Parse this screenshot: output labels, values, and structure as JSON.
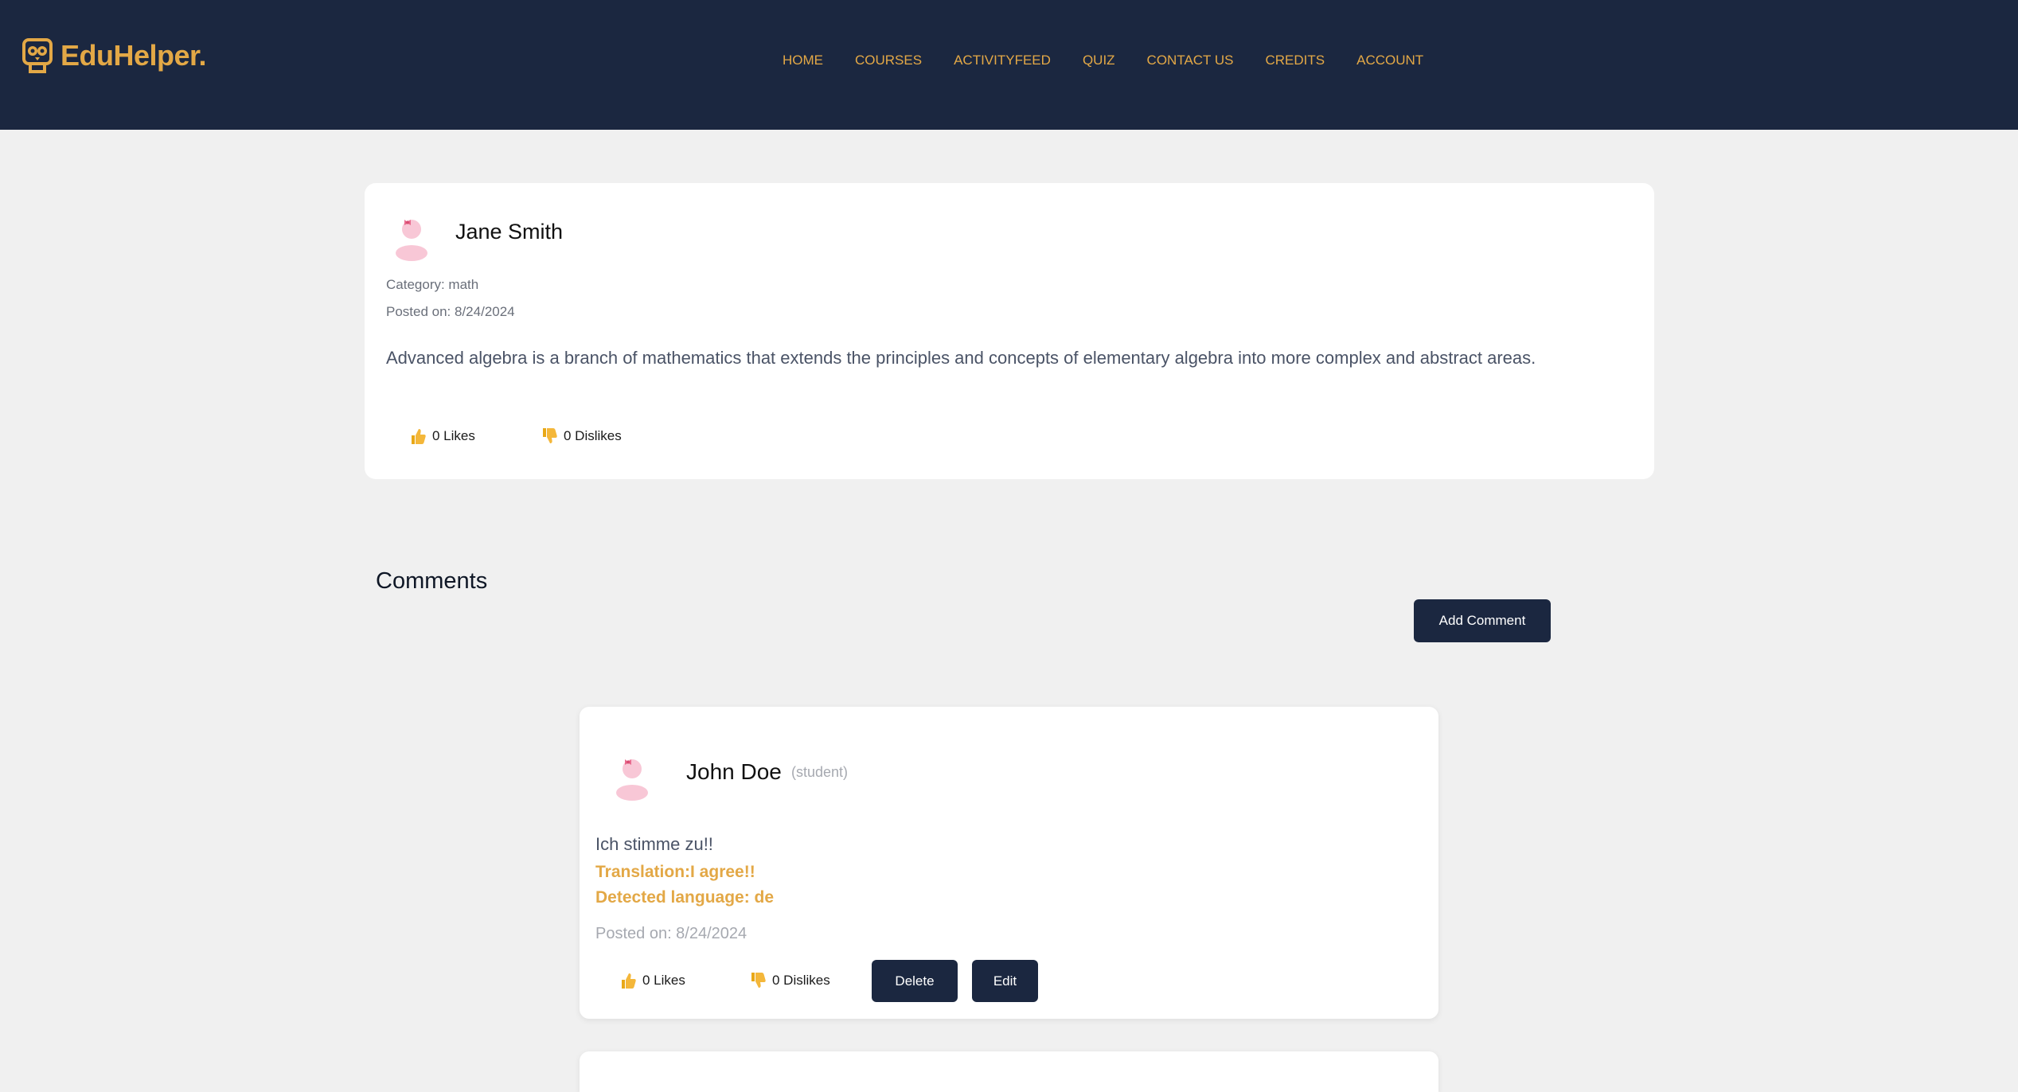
{
  "brand": {
    "name": "EduHelper."
  },
  "nav": {
    "items": [
      "HOME",
      "COURSES",
      "ACTIVITYFEED",
      "QUIZ",
      "CONTACT US",
      "CREDITS",
      "ACCOUNT"
    ]
  },
  "colors": {
    "navy": "#1b2740",
    "gold": "#e3a846",
    "background": "#f0f0f0"
  },
  "post": {
    "author": "Jane Smith",
    "category": "Category: math",
    "posted": "Posted on: 8/24/2024",
    "body": "Advanced algebra is a branch of mathematics that extends the principles and concepts of elementary algebra into more complex and abstract areas.",
    "likes": "0 Likes",
    "dislikes": "0 Dislikes",
    "avatar_icon": "user-avatar-icon",
    "like_icon": "thumbs-up-icon",
    "dislike_icon": "thumbs-down-icon"
  },
  "comments_section": {
    "title": "Comments",
    "add_button": "Add Comment"
  },
  "comments": [
    {
      "author": "John Doe",
      "role": "(student)",
      "text": "Ich stimme zu!!",
      "translation": "Translation:I agree!!",
      "language": "Detected language: de",
      "posted": "Posted on: 8/24/2024",
      "likes": "0 Likes",
      "dislikes": "0 Dislikes",
      "delete_label": "Delete",
      "edit_label": "Edit"
    }
  ]
}
